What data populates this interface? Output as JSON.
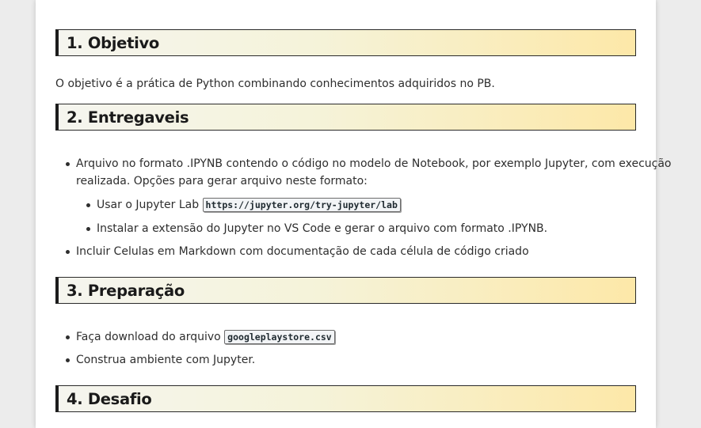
{
  "sections": [
    {
      "heading": "1. Objetivo",
      "paragraph": "O objetivo é a prática de Python combinando conhecimentos adquiridos no PB."
    },
    {
      "heading": "2. Entregaveis",
      "items": {
        "item1_line1": "Arquivo no formato .IPYNB contendo o código no modelo de Notebook, por exemplo Jupyter, com execução",
        "item1_line2": "realizada. Opções para gerar arquivo neste formato:",
        "sub1_text": "Usar o Jupyter Lab",
        "sub1_code": "https://jupyter.org/try-jupyter/lab",
        "sub2_text": "Instalar a extensão do Jupyter no VS Code e gerar o arquivo com formato .IPYNB.",
        "item2": "Incluir Celulas em Markdown com documentação de cada célula de código criado"
      }
    },
    {
      "heading": "3. Preparação",
      "items": {
        "item1_text": "Faça download do arquivo",
        "item1_code": "googleplaystore.csv",
        "item2": "Construa ambiente com Jupyter."
      }
    },
    {
      "heading": "4. Desafio"
    }
  ]
}
